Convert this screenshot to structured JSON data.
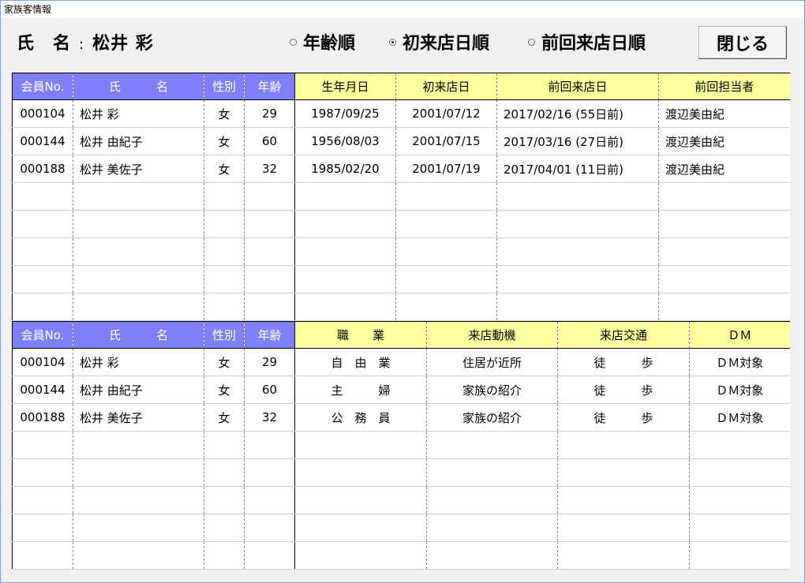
{
  "window": {
    "title": "家族客情報"
  },
  "header": {
    "name_prefix": "氏　名",
    "name_sep": ":",
    "customer_name": "松井 彩",
    "sort_options": [
      {
        "label": "年齢順",
        "checked": false
      },
      {
        "label": "初来店日順",
        "checked": true
      },
      {
        "label": "前回来店日順",
        "checked": false
      }
    ],
    "close_label": "閉じる"
  },
  "visit_table": {
    "headers": [
      "会員No.",
      "氏　　　名",
      "性別",
      "年齢",
      "生年月日",
      "初来店日",
      "前回来店日",
      "前回担当者"
    ],
    "rows": [
      [
        "000104",
        "松井 彩",
        "女",
        "29",
        "1987/09/25",
        "2001/07/12",
        "2017/02/16 (55日前)",
        "渡辺美由紀"
      ],
      [
        "000144",
        "松井 由紀子",
        "女",
        "60",
        "1956/08/03",
        "2001/07/15",
        "2017/03/16 (27日前)",
        "渡辺美由紀"
      ],
      [
        "000188",
        "松井 美佐子",
        "女",
        "32",
        "1985/02/20",
        "2001/07/19",
        "2017/04/01 (11日前)",
        "渡辺美由紀"
      ]
    ]
  },
  "profile_table": {
    "headers": [
      "会員No.",
      "氏　　　名",
      "性別",
      "年齢",
      "職　　業",
      "来店動機",
      "来店交通",
      "ＤＭ"
    ],
    "rows": [
      [
        "000104",
        "松井 彩",
        "女",
        "29",
        "自　由　業",
        "住居が近所",
        "徒　　　歩",
        "ＤＭ対象"
      ],
      [
        "000144",
        "松井 由紀子",
        "女",
        "60",
        "主　　　婦",
        "家族の紹介",
        "徒　　　歩",
        "ＤＭ対象"
      ],
      [
        "000188",
        "松井 美佐子",
        "女",
        "32",
        "公　務　員",
        "家族の紹介",
        "徒　　　歩",
        "ＤＭ対象"
      ]
    ]
  },
  "colors": {
    "header_blue": "#8080ff",
    "header_yellow": "#ffffa0"
  }
}
